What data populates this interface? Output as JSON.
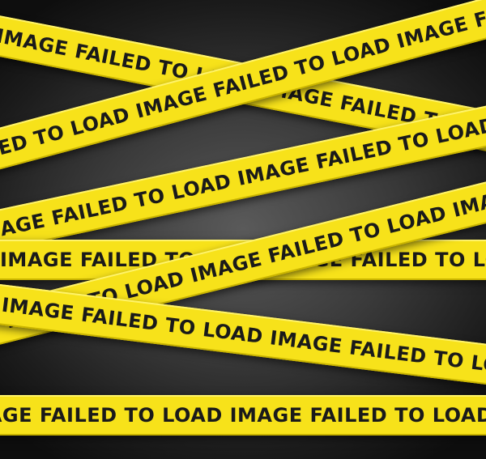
{
  "tape_text": "IMAGE FAILED TO LOAD IMAGE FAILED TO LOAD IMAGE FAILED TO LOAD IMAGE FAILED TO LOAD",
  "colors": {
    "tape": "#f7e21a",
    "text": "#1a1a1a",
    "background": "#2a2a2a"
  }
}
